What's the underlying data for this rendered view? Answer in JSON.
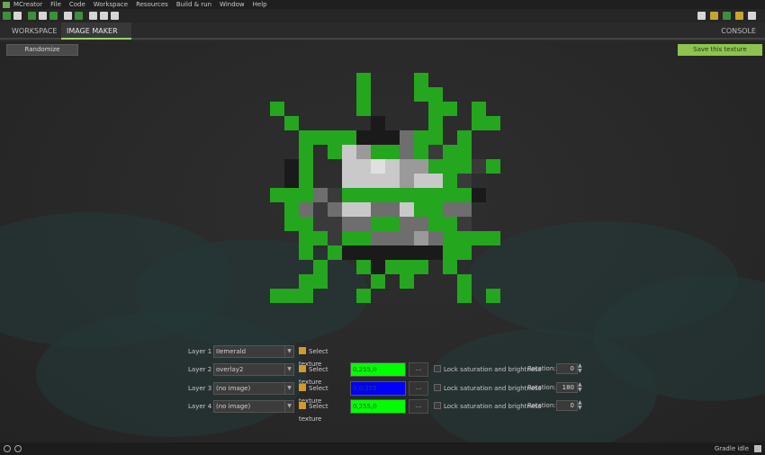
{
  "menu": {
    "items": [
      "MCreator",
      "File",
      "Code",
      "Workspace",
      "Resources",
      "Build & run",
      "Window",
      "Help"
    ]
  },
  "toolbar": {
    "left_icons": [
      "workspace-icon",
      "save-icon",
      "refresh-icon",
      "sync-icon",
      "image-icon",
      "swap-icon",
      "cloud-icon",
      "cloud-icon",
      "cloud-icon"
    ],
    "right_icons": [
      "folder-icon",
      "build-icon",
      "run-icon",
      "export-icon",
      "share-icon"
    ]
  },
  "tabs": {
    "workspace": "WORKSPACE",
    "image_maker": "IMAGE MAKER",
    "close_glyph": "×",
    "console": "CONSOLE"
  },
  "editor": {
    "randomize_label": "Randomize",
    "save_label": "Save this texture",
    "select_texture_label": "Select texture",
    "dots_label": "...",
    "lock_label": "Lock saturation and brightness",
    "rotation_label": "Rotation:"
  },
  "layers": [
    {
      "label": "Layer 1",
      "selected": "IIemerald",
      "color_text": "",
      "color": "",
      "rotation": "",
      "show_color": false
    },
    {
      "label": "Layer 2",
      "selected": "overlay2",
      "color_text": "0,255,0",
      "color": "#00ff00",
      "rotation": "0",
      "show_color": true
    },
    {
      "label": "Layer 3",
      "selected": "(no image)",
      "color_text": "0,0,255",
      "color": "#0000ff",
      "rotation": "180",
      "show_color": true
    },
    {
      "label": "Layer 4",
      "selected": "(no image)",
      "color_text": "0,255,0",
      "color": "#00ff00",
      "rotation": "0",
      "show_color": true
    }
  ],
  "texture": {
    "palette": {
      "G": "#24a61f",
      "K": "#1a1a1a",
      "D": "#3a3a3a",
      "M": "#6e6e6e",
      "L": "#9a9a9a",
      "W": "#c9c9c9",
      "X": "#e0e0e0"
    },
    "pixels": [
      "......G...G.....",
      "......G...GG....",
      "G.....G....GG.G.",
      ".G.....K...G..GG",
      "..GGGGKKKMGG.G..",
      "..G.GWLGGMGDGG..",
      ".KG..WWXWLLGGGDG",
      ".KG..WWWWLWWGD..",
      "GGGMDGGGGGGGGGK.",
      ".GMDMWWMMWGGMM..",
      ".GGDDMMGGMMGGD..",
      "..GGDGGMMMLMGGGG",
      "..G.GKKKKKKKGG..",
      "...G..GKGGG.G...",
      "..GG...G.G...G..",
      "GGG...G......G.G"
    ]
  },
  "status": {
    "gradle": "Gradle idle"
  }
}
